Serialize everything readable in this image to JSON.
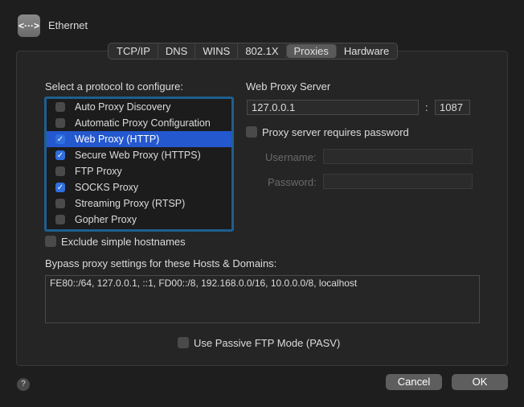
{
  "window": {
    "title": "Ethernet",
    "icon": "ethernet-icon",
    "icon_glyph": "<···>"
  },
  "tabs": [
    {
      "label": "TCP/IP"
    },
    {
      "label": "DNS"
    },
    {
      "label": "WINS"
    },
    {
      "label": "802.1X"
    },
    {
      "label": "Proxies",
      "selected": true
    },
    {
      "label": "Hardware"
    }
  ],
  "protocol_label": "Select a protocol to configure:",
  "protocols": [
    {
      "label": "Auto Proxy Discovery",
      "checked": false
    },
    {
      "label": "Automatic Proxy Configuration",
      "checked": false
    },
    {
      "label": "Web Proxy (HTTP)",
      "checked": true,
      "selected": true
    },
    {
      "label": "Secure Web Proxy (HTTPS)",
      "checked": true
    },
    {
      "label": "FTP Proxy",
      "checked": false
    },
    {
      "label": "SOCKS Proxy",
      "checked": true
    },
    {
      "label": "Streaming Proxy (RTSP)",
      "checked": false
    },
    {
      "label": "Gopher Proxy",
      "checked": false
    }
  ],
  "server": {
    "label": "Web Proxy Server",
    "host": "127.0.0.1",
    "sep": ":",
    "port": "1087",
    "password_required_label": "Proxy server requires password",
    "username_label": "Username:",
    "password_label": "Password:"
  },
  "exclude_label": "Exclude simple hostnames",
  "bypass": {
    "label": "Bypass proxy settings for these Hosts & Domains:",
    "value": "FE80::/64, 127.0.0.1, ::1, FD00::/8, 192.168.0.0/16, 10.0.0.0/8, localhost"
  },
  "pasv_label": "Use Passive FTP Mode (PASV)",
  "buttons": {
    "help": "?",
    "cancel": "Cancel",
    "ok": "OK"
  },
  "colors": {
    "selection": "#2458cf",
    "focus": "#1f5f8f"
  }
}
